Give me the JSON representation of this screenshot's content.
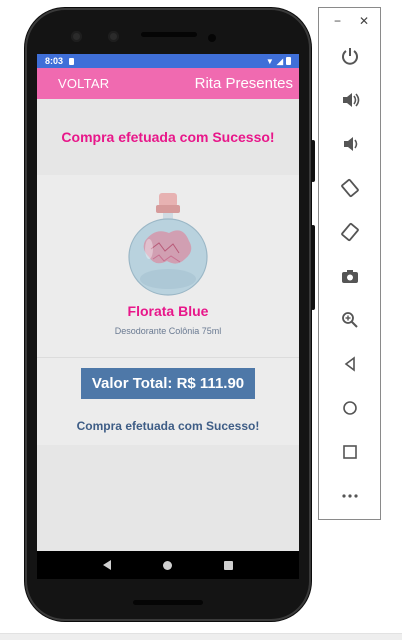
{
  "status_bar": {
    "time": "8:03"
  },
  "app_bar": {
    "back_label": "VOLTAR",
    "title": "Rita Presentes"
  },
  "banner": {
    "text": "Compra efetuada com Sucesso!"
  },
  "product": {
    "name": "Florata Blue",
    "description": "Desodorante Colônia 75ml"
  },
  "total": {
    "label": "Valor Total: R$ 111.90"
  },
  "confirmation": {
    "text": "Compra efetuada com Sucesso!"
  },
  "emulator_toolbar": {
    "window_controls": [
      "minimize-icon",
      "close-icon"
    ],
    "tools": [
      "power-icon",
      "volume-up-icon",
      "volume-down-icon",
      "rotate-left-icon",
      "rotate-right-icon",
      "camera-icon",
      "zoom-icon",
      "back-icon",
      "home-icon",
      "overview-icon",
      "more-icon"
    ]
  },
  "colors": {
    "app_bar": "#f06ab0",
    "status_bar": "#3f6fd8",
    "accent_pink": "#e8178a",
    "total_bg": "#4e78a8",
    "success_text": "#3e5d86"
  }
}
